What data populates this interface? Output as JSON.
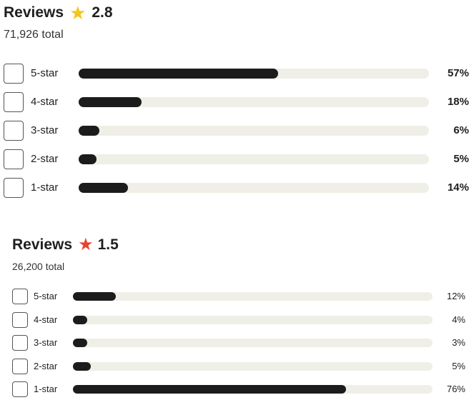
{
  "summaries": [
    {
      "title": "Reviews",
      "star_icon": "star-icon",
      "star_color": "#f5c518",
      "rating": "2.8",
      "total": "71,926 total",
      "rows": [
        {
          "label": "5-star",
          "percent": 57,
          "percent_label": "57%"
        },
        {
          "label": "4-star",
          "percent": 18,
          "percent_label": "18%"
        },
        {
          "label": "3-star",
          "percent": 6,
          "percent_label": "6%"
        },
        {
          "label": "2-star",
          "percent": 5,
          "percent_label": "5%"
        },
        {
          "label": "1-star",
          "percent": 14,
          "percent_label": "14%"
        }
      ]
    },
    {
      "title": "Reviews",
      "star_icon": "star-icon",
      "star_color": "#e8432f",
      "rating": "1.5",
      "total": "26,200 total",
      "rows": [
        {
          "label": "5-star",
          "percent": 12,
          "percent_label": "12%"
        },
        {
          "label": "4-star",
          "percent": 4,
          "percent_label": "4%"
        },
        {
          "label": "3-star",
          "percent": 3,
          "percent_label": "3%"
        },
        {
          "label": "2-star",
          "percent": 5,
          "percent_label": "5%"
        },
        {
          "label": "1-star",
          "percent": 76,
          "percent_label": "76%"
        }
      ]
    }
  ],
  "colors": {
    "bar_fill": "#1c1c1c",
    "bar_track": "#f0efe7"
  }
}
